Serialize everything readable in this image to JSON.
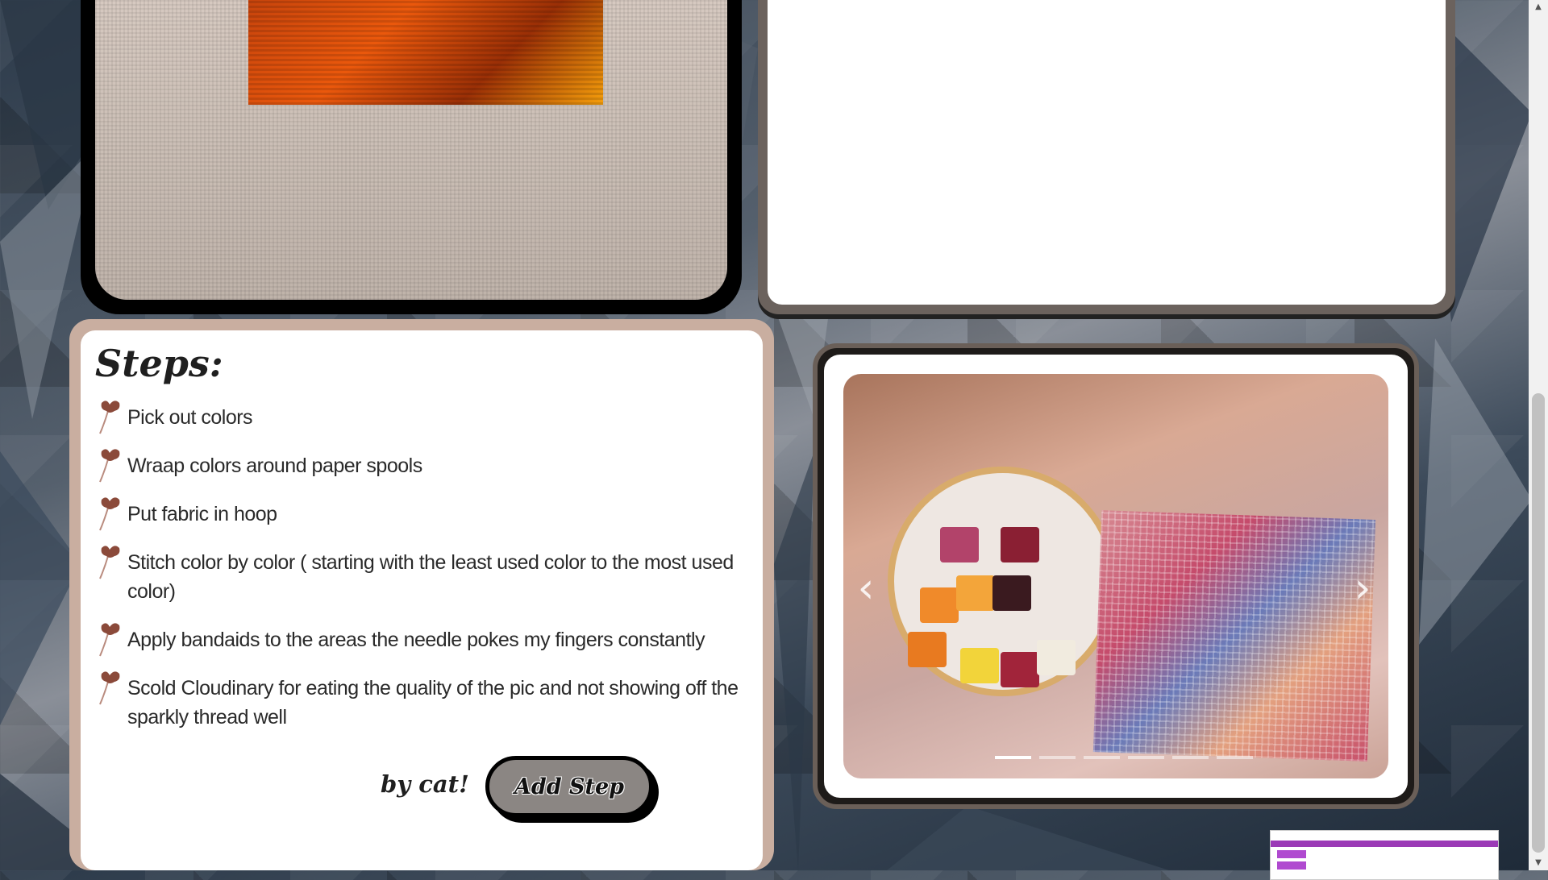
{
  "steps": {
    "title": "Steps:",
    "items": [
      "Pick out colors",
      "Wraap colors around paper spools",
      "Put fabric in hoop",
      "Stitch color by color ( starting with the least used color to the most used color)",
      "Apply bandaids to the areas the needle pokes my fingers constantly",
      "Scold Cloudinary for eating the quality of the pic and not showing off the sparkly thread well"
    ],
    "icon": "flower-bullet-icon"
  },
  "footer": {
    "byline": "by cat!",
    "add_step_label": "Add Step"
  },
  "carousel": {
    "prev_label": "‹",
    "next_label": "›",
    "slide_count": 6,
    "active_index": 0
  },
  "colors": {
    "steps_border": "#c9aea0",
    "carousel_border": "#1e1b19",
    "button_fill": "#8b8683",
    "bullet": "#8b4a3a"
  }
}
